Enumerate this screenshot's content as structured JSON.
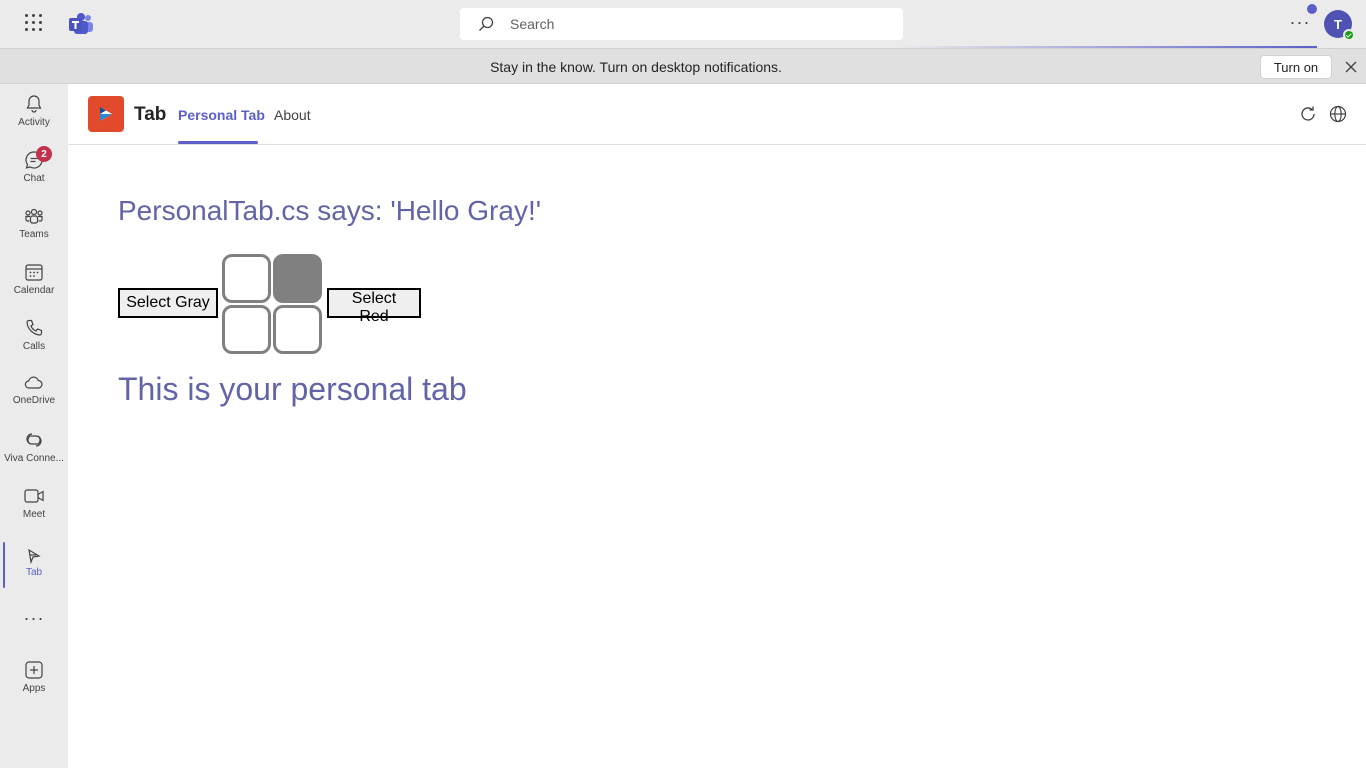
{
  "topbar": {
    "search_placeholder": "Search",
    "more_label": "···",
    "avatar_initial": "T",
    "icons": [
      "waffle-icon",
      "teams-logo-icon",
      "search-icon",
      "more-icon"
    ]
  },
  "notification": {
    "message": "Stay in the know. Turn on desktop notifications.",
    "button_label": "Turn on"
  },
  "rail": {
    "items": [
      {
        "label": "Activity",
        "icon": "bell-icon"
      },
      {
        "label": "Chat",
        "icon": "chat-icon",
        "badge": "2"
      },
      {
        "label": "Teams",
        "icon": "teams-icon"
      },
      {
        "label": "Calendar",
        "icon": "calendar-icon"
      },
      {
        "label": "Calls",
        "icon": "phone-icon"
      },
      {
        "label": "OneDrive",
        "icon": "cloud-icon"
      },
      {
        "label": "Viva Conne...",
        "icon": "viva-icon"
      },
      {
        "label": "Meet",
        "icon": "video-icon"
      },
      {
        "label": "Tab",
        "icon": "tab-app-icon",
        "active": true
      },
      {
        "label": "Apps",
        "icon": "add-apps-icon"
      }
    ],
    "more_label": "···"
  },
  "app": {
    "name": "Tab",
    "tabs": [
      {
        "label": "Personal Tab",
        "active": true
      },
      {
        "label": "About",
        "active": false
      }
    ]
  },
  "content": {
    "greeting": "PersonalTab.cs says: 'Hello Gray!'",
    "select_gray_label": "Select Gray",
    "select_red_label": "Select Red",
    "grid_filled": [
      false,
      true,
      false,
      false
    ],
    "footer_text": "This is your personal tab"
  },
  "colors": {
    "accent": "#5b5fc7",
    "heading": "#6264a7",
    "app_icon_bg": "#e14b2b",
    "badge": "#c4314b",
    "selected_cell": "#808080"
  }
}
